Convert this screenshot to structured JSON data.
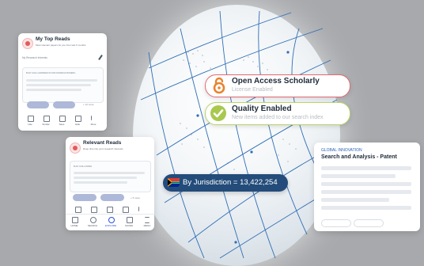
{
  "top_reads": {
    "title": "My Top Reads",
    "subtitle": "Most relevant papers for you from last 6 months",
    "interests_label": "My Research Interests",
    "summary_placeholder": "BUILT LIKE A GRAMMER OF DISCOVERINGS MODERN...",
    "more_label": "+ 12 more",
    "actions": [
      "Like",
      "Similar",
      "Save",
      "Hide",
      "More"
    ]
  },
  "relevant_reads": {
    "title": "Relevant Reads",
    "subtitle": "Deep dive into your research interests",
    "summary_placeholder": "BUILT LIKE A PAPER",
    "more_label": "+ 5 more",
    "nav": [
      "HOME",
      "SEARCH",
      "EXPLORE",
      "SAVED",
      "MENU"
    ]
  },
  "open_access": {
    "title": "Open Access Scholarly",
    "subtitle": "License Enabled",
    "icon": "open-access-lock-icon",
    "accent": "#e06a73"
  },
  "quality": {
    "title": "Quality Enabled",
    "subtitle": "New items added to our search index",
    "icon": "checkmark-icon",
    "accent": "#a8c94e"
  },
  "jurisdiction": {
    "text": "By Jurisdiction = 13,422,254",
    "icon": "south-africa-flag-icon",
    "accent": "#234c7a"
  },
  "global_innovation": {
    "kicker": "GLOBAL INNOVATION",
    "title": "Search and Analysis - Patent"
  }
}
